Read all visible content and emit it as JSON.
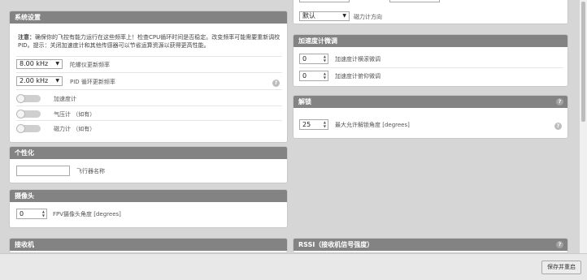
{
  "system_config": {
    "title": "系统设置",
    "note_label": "注意：",
    "note_text": "确保你的飞控有能力运行在这些频率上！检查CPU循环时间是否稳定。改变频率可能需要重新调校PID。提示：关闭加速度计和其他传感器可以节省运算资源以获得更高性能。",
    "gyro_freq": {
      "value": "8.00 kHz",
      "label": "陀螺仪更新频率"
    },
    "pid_freq": {
      "value": "2.00 kHz",
      "label": "PID 循环更新频率"
    },
    "toggles": [
      {
        "label": "加速度计",
        "enabled": false
      },
      {
        "label": "气压计 （如有）",
        "enabled": false
      },
      {
        "label": "磁力计 （如有）",
        "enabled": false
      }
    ]
  },
  "personalization": {
    "title": "个性化",
    "craft_name": {
      "value": "",
      "label": "飞行器名称"
    }
  },
  "camera": {
    "title": "摄像头",
    "fpv_angle": {
      "value": "0",
      "label": "FPV摄像头角度 [degrees]"
    }
  },
  "receiver": {
    "title": "接收机"
  },
  "magnetometer": {
    "alignment": {
      "value": "默认",
      "label": "磁力计方向"
    }
  },
  "accel_trim": {
    "title": "加速度计微调",
    "roll": {
      "value": "0",
      "label": "加速度计横滚微调"
    },
    "pitch": {
      "value": "0",
      "label": "加速度计俯仰微调"
    }
  },
  "arming": {
    "title": "解锁",
    "max_angle": {
      "value": "25",
      "label": "最大允许解锁角度 [degrees]"
    }
  },
  "rssi": {
    "title": "RSSI（接收机信号强度）"
  },
  "footer": {
    "save_label": "保存并重启"
  },
  "icons": {
    "help": "help-icon",
    "dropdown": "chevron-down-icon",
    "spinner": "spinner-arrows-icon"
  },
  "colors": {
    "panel_header": "#838383",
    "background": "#d6d6d6"
  }
}
